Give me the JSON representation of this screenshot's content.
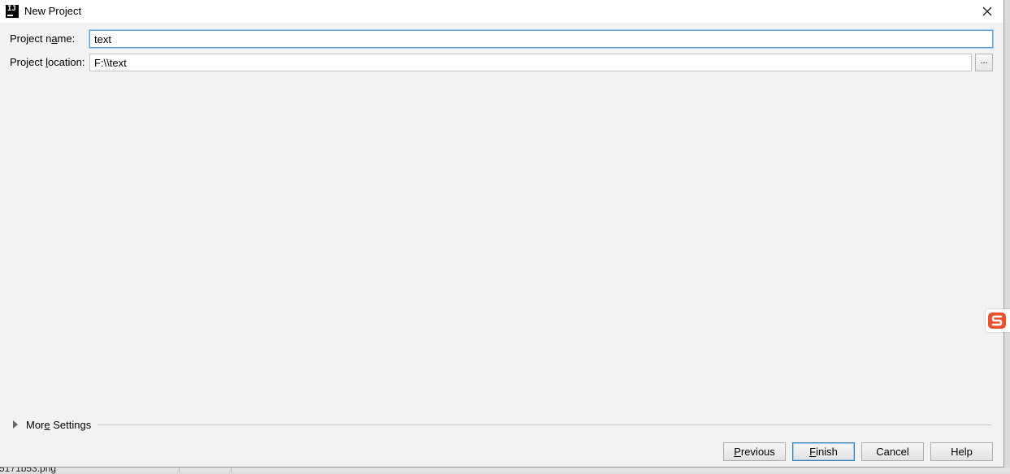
{
  "window": {
    "title": "New Project",
    "app_icon_text": "IJ"
  },
  "form": {
    "project_name": {
      "label_pre": "Project n",
      "label_mnemonic": "a",
      "label_post": "me:",
      "value": "text"
    },
    "project_location": {
      "label_pre": "Project ",
      "label_mnemonic": "l",
      "label_post": "ocation:",
      "value": "F:\\\\text",
      "browse_label": "..."
    }
  },
  "more_settings": {
    "label_pre": "Mor",
    "label_mnemonic": "e",
    "label_post": " Settings"
  },
  "buttons": {
    "previous": {
      "mnemonic": "P",
      "rest": "revious"
    },
    "finish": {
      "mnemonic": "F",
      "rest": "inish"
    },
    "cancel": {
      "label": "Cancel"
    },
    "help": {
      "label": "Help"
    }
  },
  "taskbar": {
    "file_fragment": "5171b53.png"
  },
  "colors": {
    "accent_focus": "#5a9fd6",
    "ime_brand": "#e8532e"
  },
  "icons": {
    "app": "intellij-idea-icon",
    "close": "close-icon",
    "expand": "triangle-right-icon",
    "ime": "sogou-ime-icon"
  }
}
